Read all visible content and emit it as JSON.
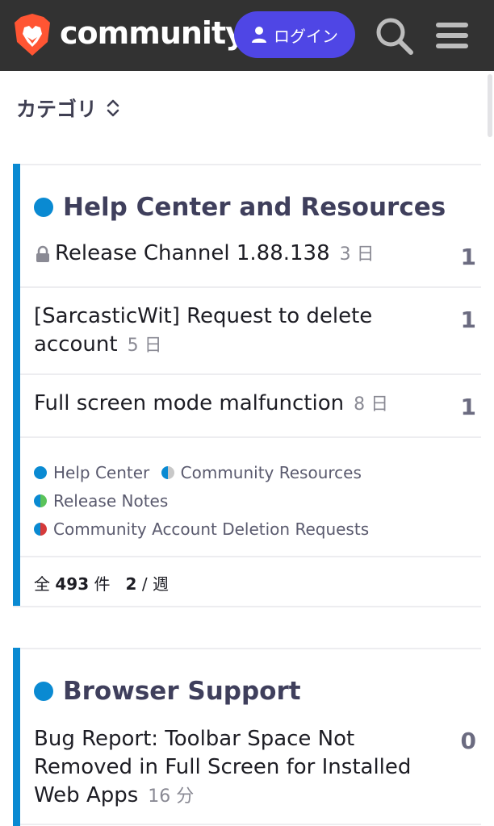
{
  "header": {
    "brand": "community",
    "login_label": "ログイン",
    "colors": {
      "bg": "#323232",
      "login": "#4f46e5",
      "logo": "#ff5533"
    }
  },
  "category_selector": {
    "label": "カテゴリ"
  },
  "categories": [
    {
      "title": "Help Center and Resources",
      "color": "#0a8ad2",
      "topics": [
        {
          "title": "Release Channel 1.88.138",
          "age": "3 日",
          "count": "1",
          "locked": true
        },
        {
          "title_line1": "[SarcasticWit] Request to delete",
          "title_line2": "account",
          "age": "5 日",
          "count": "1"
        },
        {
          "title": "Full screen mode malfunction",
          "age": "8 日",
          "count": "1"
        }
      ],
      "subcategories": [
        {
          "name": "Help Center"
        },
        {
          "name": "Community Resources"
        },
        {
          "name": "Release Notes"
        },
        {
          "name": "Community Account Deletion Requests"
        }
      ],
      "stats": {
        "prefix": "全",
        "total": "493",
        "unit": "件",
        "rate": "2",
        "rate_sep": "/",
        "rate_unit": "週"
      }
    },
    {
      "title": "Browser Support",
      "color": "#0a8ad2",
      "topics": [
        {
          "title_line1": "Bug Report: Toolbar Space Not",
          "title_line2": "Removed in Full Screen for Installed",
          "title_line3": "Web Apps",
          "age": "16 分",
          "count": "0"
        }
      ]
    }
  ]
}
